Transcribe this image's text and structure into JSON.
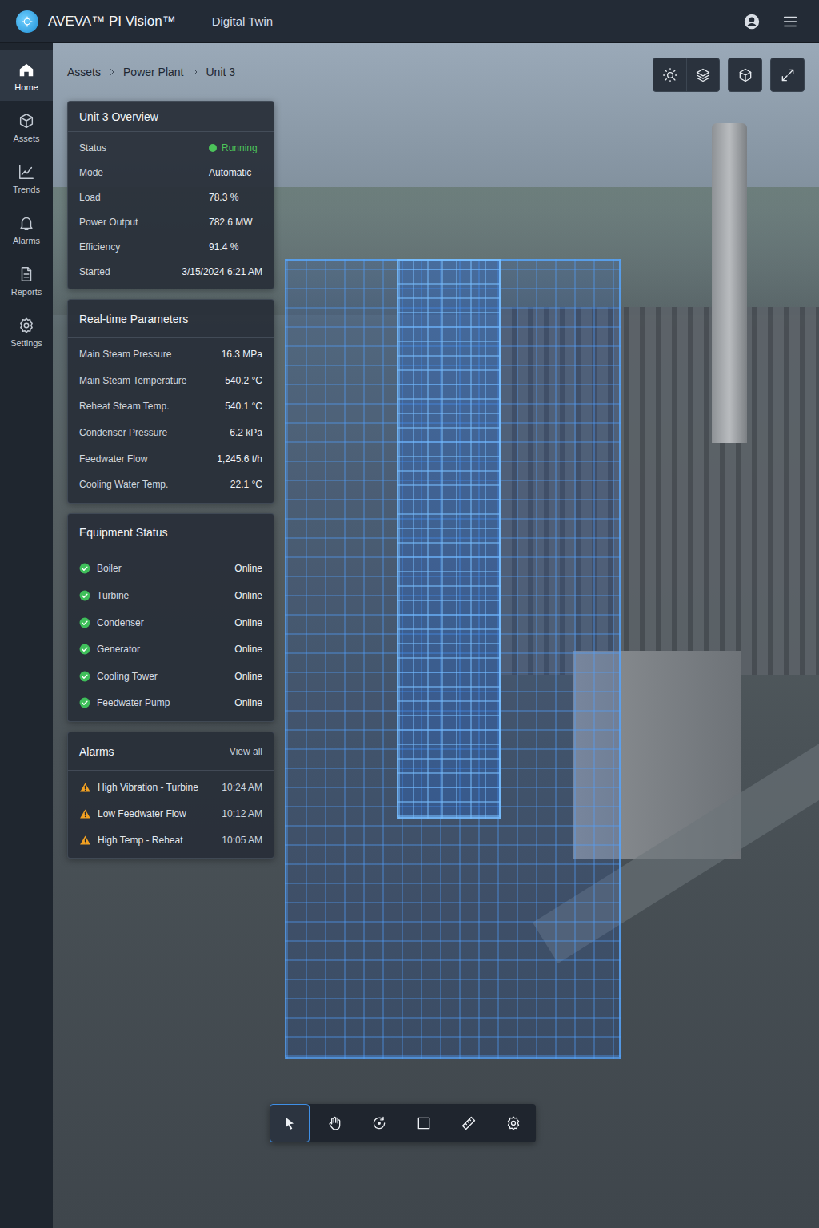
{
  "header": {
    "title": "AVEVA™ PI Vision™",
    "subtitle": "Digital Twin"
  },
  "sidebar": {
    "items": [
      {
        "label": "Home",
        "selected": true
      },
      {
        "label": "Assets",
        "selected": false
      },
      {
        "label": "Trends",
        "selected": false
      },
      {
        "label": "Alarms",
        "selected": false
      },
      {
        "label": "Reports",
        "selected": false
      },
      {
        "label": "Settings",
        "selected": false
      }
    ]
  },
  "breadcrumb": [
    "Assets",
    "Power Plant",
    "Unit 3"
  ],
  "overview": {
    "title": "Unit 3 Overview",
    "rows": [
      {
        "label": "Status",
        "value": "Running",
        "kind": "status",
        "color": "#4cc35a"
      },
      {
        "label": "Mode",
        "value": "Automatic",
        "kind": "text"
      },
      {
        "label": "Load",
        "value": "78.3 %",
        "kind": "text"
      },
      {
        "label": "Power Output",
        "value": "782.6 MW",
        "kind": "text"
      },
      {
        "label": "Efficiency",
        "value": "91.4 %",
        "kind": "text"
      },
      {
        "label": "Started",
        "value": "3/15/2024 6:21 AM",
        "kind": "text"
      }
    ]
  },
  "parameters": {
    "title": "Real-time Parameters",
    "rows": [
      {
        "label": "Main Steam Pressure",
        "value": "16.3 MPa"
      },
      {
        "label": "Main Steam Temperature",
        "value": "540.2 °C"
      },
      {
        "label": "Reheat Steam Temp.",
        "value": "540.1 °C"
      },
      {
        "label": "Condenser Pressure",
        "value": "6.2 kPa"
      },
      {
        "label": "Feedwater Flow",
        "value": "1,245.6 t/h"
      },
      {
        "label": "Cooling Water Temp.",
        "value": "22.1 °C"
      }
    ]
  },
  "equipment": {
    "title": "Equipment Status",
    "items": [
      {
        "name": "Boiler",
        "status": "Online",
        "ok": true
      },
      {
        "name": "Turbine",
        "status": "Online",
        "ok": true
      },
      {
        "name": "Condenser",
        "status": "Online",
        "ok": true
      },
      {
        "name": "Generator",
        "status": "Online",
        "ok": true
      },
      {
        "name": "Cooling Tower",
        "status": "Online",
        "ok": true
      },
      {
        "name": "Feedwater Pump",
        "status": "Online",
        "ok": true
      }
    ]
  },
  "alarms": {
    "title": "Alarms",
    "link": "View all",
    "items": [
      {
        "text": "High Vibration - Turbine",
        "time": "10:24 AM",
        "severity": "warning"
      },
      {
        "text": "Low Feedwater Flow",
        "time": "10:12 AM",
        "severity": "warning"
      },
      {
        "text": "High Temp - Reheat",
        "time": "10:05 AM",
        "severity": "warning"
      }
    ]
  },
  "toolbar": {
    "tools": [
      {
        "selected": true
      },
      {
        "selected": false
      },
      {
        "selected": false
      },
      {
        "selected": false
      },
      {
        "selected": false
      },
      {
        "selected": false
      }
    ]
  }
}
